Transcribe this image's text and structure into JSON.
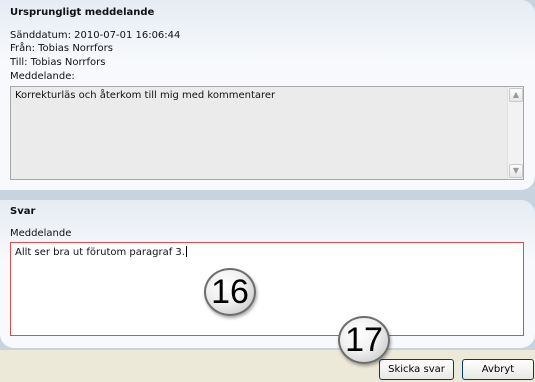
{
  "original_message": {
    "title": "Ursprungligt meddelande",
    "sent_date": "Sänddatum: 2010-07-01 16:06:44",
    "from": "Från: Tobias Norrfors",
    "to": "Till: Tobias Norrfors",
    "message_label": "Meddelande:",
    "message_text": "Korrekturläs och återkom till mig med kommentarer"
  },
  "reply": {
    "title": "Svar",
    "message_label": "Meddelande",
    "message_text": "Allt ser bra ut förutom paragraf 3."
  },
  "callouts": {
    "badge_16": "16",
    "badge_17": "17"
  },
  "buttons": {
    "send_label": "Skicka svar",
    "cancel_label": "Avbryt"
  },
  "icons": {
    "scroll_up": "scroll-up-arrow-icon",
    "scroll_down": "scroll-down-arrow-icon"
  },
  "colors": {
    "reply_field_border": "#e24b4b",
    "button_border": "#003c74"
  }
}
